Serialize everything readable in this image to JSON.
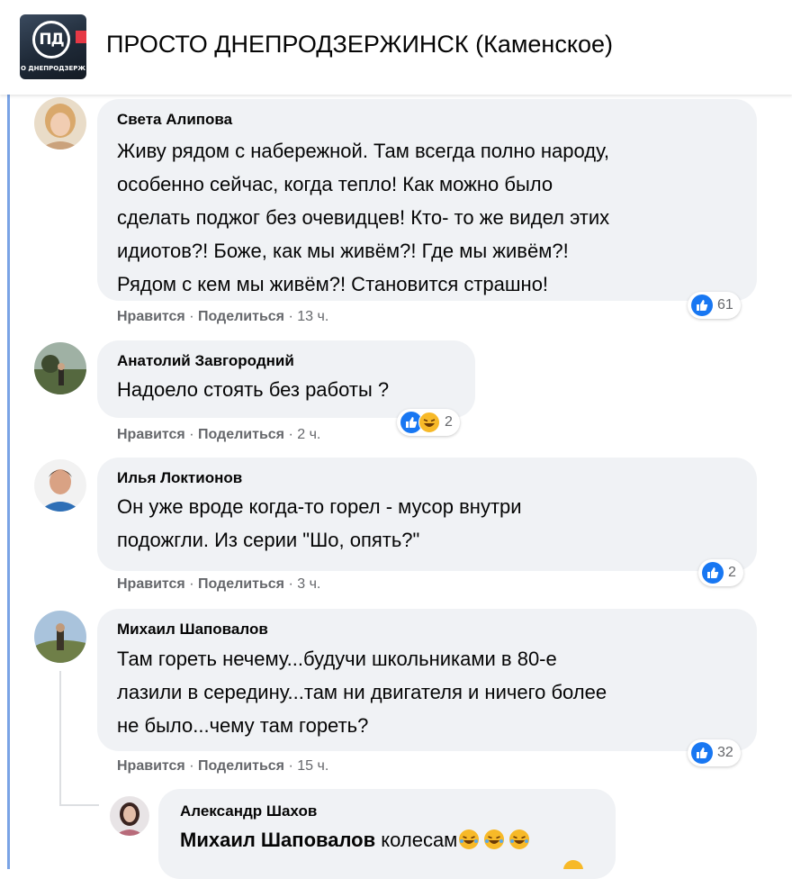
{
  "page": {
    "title": "ПРОСТО ДНЕПРОДЗЕРЖИНСК (Каменское)",
    "logo_initials": "ПД",
    "logo_text": "О ДНЕПРОДЗЕРЖ"
  },
  "comments": [
    {
      "author": "Света Алипова",
      "lines": [
        "Живу рядом с набережной. Там всегда полно народу,",
        "особенно сейчас, когда тепло! Как можно было",
        "сделать поджог без очевидцев! Кто- то же видел этих",
        "идиотов?! Боже, как мы живём?! Где мы живём?!",
        "Рядом с кем мы живём?! Становится страшно!"
      ],
      "reactions": "61",
      "like": "Нравится",
      "reply": "Поделиться",
      "time": "13 ч."
    },
    {
      "author": "Анатолий Завгородний",
      "lines": [
        "Надоело стоять без работы  ?"
      ],
      "reactions": "2",
      "like": "Нравится",
      "reply": "Поделиться",
      "time": "2 ч."
    },
    {
      "author": "Илья Локтионов",
      "lines": [
        "Он уже вроде когда-то горел - мусор внутри",
        "подожгли. Из серии \"Шо, опять?\""
      ],
      "reactions": "2",
      "like": "Нравится",
      "reply": "Поделиться",
      "time": "3 ч."
    },
    {
      "author": "Михаил Шаповалов",
      "lines": [
        "Там гореть нечему...будучи школьниками в 80-е",
        "лазили в середину...там ни двигателя и ничего более",
        "не было...чему там гореть?"
      ],
      "reactions": "32",
      "like": "Нравится",
      "reply": "Поделиться",
      "time": "15 ч."
    }
  ],
  "reply": {
    "author": "Александр Шахов",
    "mention": "Михаил Шаповалов",
    "text": "колесам"
  },
  "colors": {
    "like_blue": "#1877f2",
    "haha_yellow": "#f7b928",
    "bubble": "#f0f2f5",
    "meta_gray": "#65676b"
  }
}
